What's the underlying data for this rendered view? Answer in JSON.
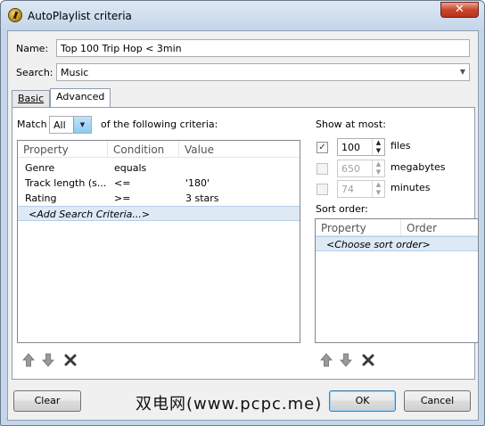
{
  "window": {
    "title": "AutoPlaylist criteria",
    "close": "✕"
  },
  "name_label": "Name:",
  "name_value": "Top 100 Trip Hop < 3min",
  "search_label": "Search:",
  "search_value": "Music",
  "tabs": [
    {
      "label": "Basic"
    },
    {
      "label": "Advanced"
    }
  ],
  "match": {
    "label": "Match",
    "value": "All",
    "suffix": "of the following criteria:"
  },
  "criteria": {
    "columns": [
      "Property",
      "Condition",
      "Value"
    ],
    "rows": [
      {
        "property": "Genre",
        "condition": "equals",
        "value": ""
      },
      {
        "property": "Track length (s...",
        "condition": "<=",
        "value": "'180'"
      },
      {
        "property": "Rating",
        "condition": ">=",
        "value": "3 stars"
      }
    ],
    "add_label": "<Add Search Criteria...>"
  },
  "show_at_most": {
    "label": "Show at most:",
    "items": [
      {
        "value": "100",
        "unit": "files",
        "checked": true
      },
      {
        "value": "650",
        "unit": "megabytes",
        "checked": false
      },
      {
        "value": "74",
        "unit": "minutes",
        "checked": false
      }
    ]
  },
  "sort_order": {
    "label": "Sort order:",
    "columns": [
      "Property",
      "Order"
    ],
    "choose_label": "<Choose sort order>"
  },
  "buttons": {
    "clear": "Clear",
    "ok": "OK",
    "cancel": "Cancel"
  },
  "watermark": "双电网(www.pcpc.me)"
}
